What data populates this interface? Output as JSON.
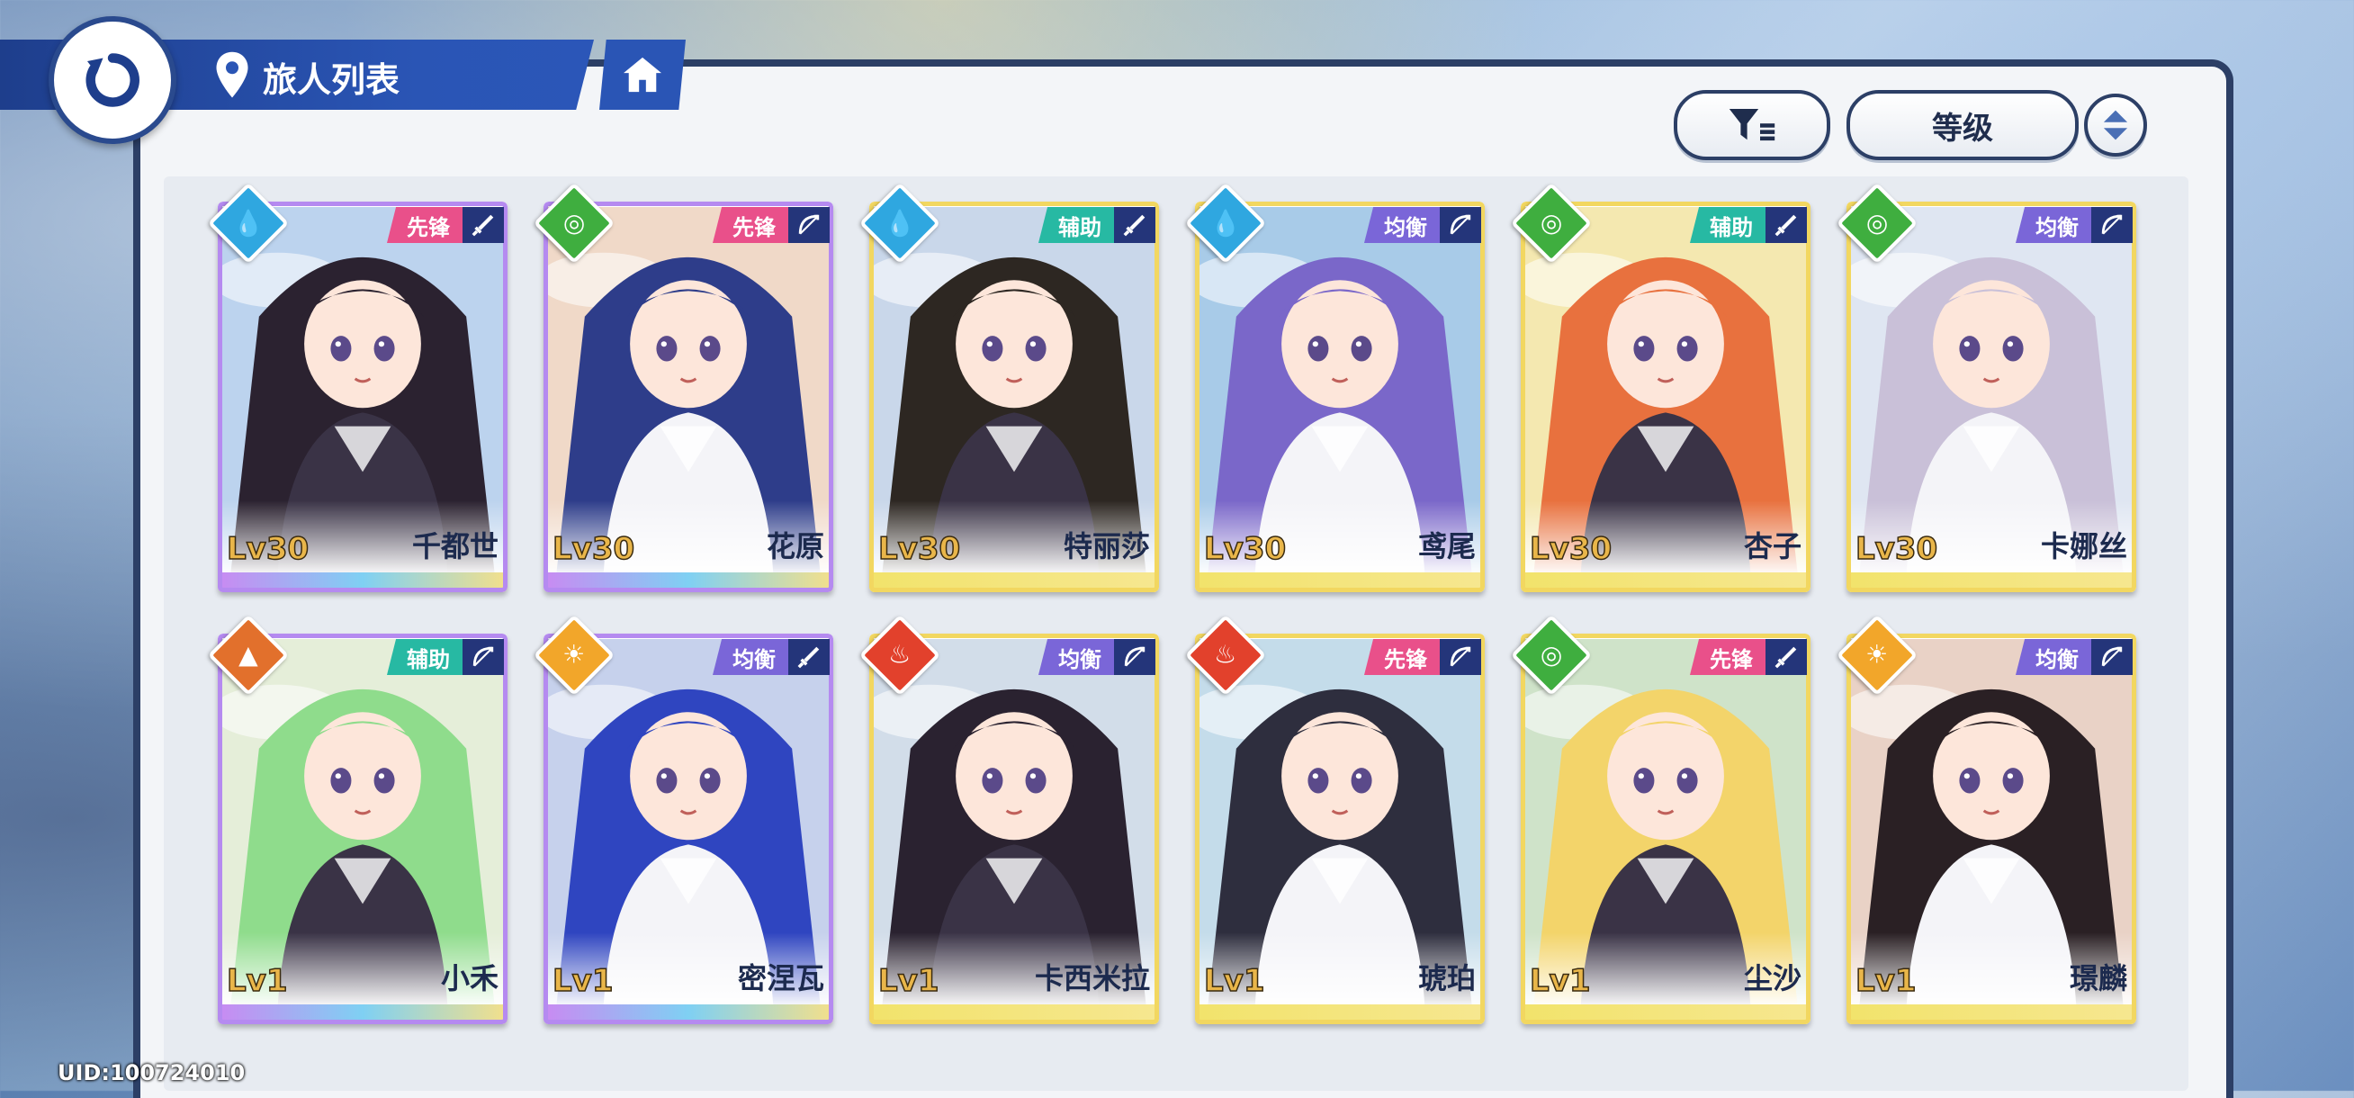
{
  "header": {
    "title": "旅人列表",
    "back_icon": "back-arrow-icon",
    "home_icon": "home-icon",
    "pin_icon": "location-pin-icon"
  },
  "toolbar": {
    "filter_icon": "filter-icon",
    "sort_label": "等级",
    "order_icon": "sort-order-icon"
  },
  "colors": {
    "frame_blue": "#2c3f66",
    "title_blue": "#2a55b5",
    "pink_role": "#e9508a",
    "teal_role": "#27b9a3",
    "purple_role": "#7a66d8"
  },
  "characters": [
    {
      "name": "千都世",
      "level": "Lv30",
      "role": "先锋",
      "weapon": "sword",
      "element": "water"
    },
    {
      "name": "花原",
      "level": "Lv30",
      "role": "先锋",
      "weapon": "bow",
      "element": "wind"
    },
    {
      "name": "特丽莎",
      "level": "Lv30",
      "role": "辅助",
      "weapon": "sword",
      "element": "water"
    },
    {
      "name": "鸢尾",
      "level": "Lv30",
      "role": "均衡",
      "weapon": "bow",
      "element": "water"
    },
    {
      "name": "杏子",
      "level": "Lv30",
      "role": "辅助",
      "weapon": "sword",
      "element": "wind"
    },
    {
      "name": "卡娜丝",
      "level": "Lv30",
      "role": "均衡",
      "weapon": "bow",
      "element": "wind"
    },
    {
      "name": "小禾",
      "level": "Lv1",
      "role": "辅助",
      "weapon": "bow",
      "element": "earth"
    },
    {
      "name": "密涅瓦",
      "level": "Lv1",
      "role": "均衡",
      "weapon": "sword",
      "element": "light"
    },
    {
      "name": "卡西米拉",
      "level": "Lv1",
      "role": "均衡",
      "weapon": "bow",
      "element": "fire"
    },
    {
      "name": "琥珀",
      "level": "Lv1",
      "role": "先锋",
      "weapon": "bow",
      "element": "fire"
    },
    {
      "name": "尘沙",
      "level": "Lv1",
      "role": "先锋",
      "weapon": "sword",
      "element": "wind"
    },
    {
      "name": "璟麟",
      "level": "Lv1",
      "role": "均衡",
      "weapon": "bow",
      "element": "light"
    }
  ],
  "footer": {
    "uid": "UID:100724010"
  }
}
